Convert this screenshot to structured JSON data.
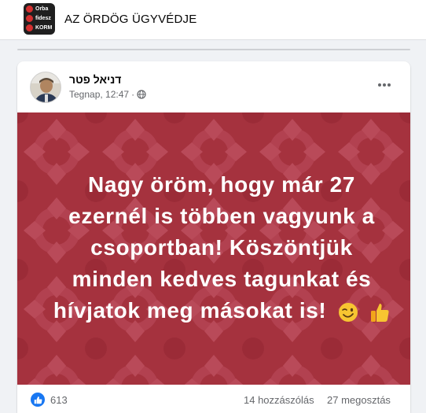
{
  "group": {
    "title": "AZ ÖRDÖG ÜGYVÉDJE",
    "thumb_lines": [
      "Orba",
      "fidesz",
      "KORM"
    ]
  },
  "post": {
    "author": "דניאל פטר",
    "time": "Tegnap, 12:47",
    "audience_icon": "globe-icon",
    "more_icon": "more-horizontal-icon",
    "banner_lines": [
      "Nagy öröm, hogy már 27",
      "ezernél is többen vagyunk a",
      "csoportban! Köszöntjük",
      "minden kedves tagunkat és",
      "hívjatok meg másokat is!"
    ],
    "banner_emojis": [
      "winking-face-emoji",
      "thumbs-up-emoji"
    ],
    "banner_color": "#a5323e"
  },
  "footer": {
    "reaction_icon": "like-reaction-icon",
    "reactions": "613",
    "comments": "14 hozzászólás",
    "shares": "27 megosztás"
  },
  "colors": {
    "accent": "#1877f2",
    "muted_text": "#65676b",
    "page_bg": "#f0f2f5"
  }
}
